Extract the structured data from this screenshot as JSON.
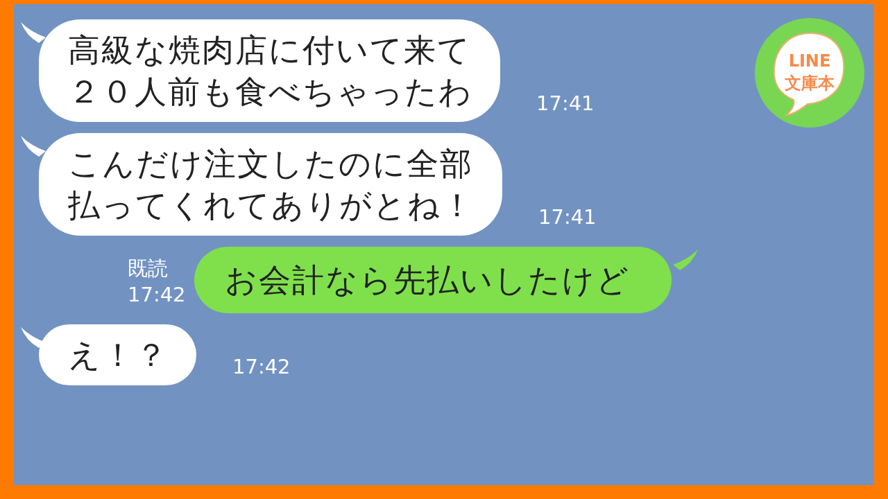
{
  "logo": {
    "line1": "LINE",
    "line2": "文庫本"
  },
  "messages": [
    {
      "kind": "received",
      "lines": [
        "高級な焼肉店に付いて来て",
        "２０人前も食べちゃったわ"
      ],
      "time": "17:41"
    },
    {
      "kind": "received",
      "lines": [
        "こんだけ注文したのに全部",
        "払ってくれてありがとね！"
      ],
      "time": "17:41"
    },
    {
      "kind": "sent",
      "lines": [
        "お会計なら先払いしたけど"
      ],
      "read": "既読",
      "time": "17:42"
    },
    {
      "kind": "received",
      "lines": [
        "え！？"
      ],
      "time": "17:42"
    }
  ]
}
